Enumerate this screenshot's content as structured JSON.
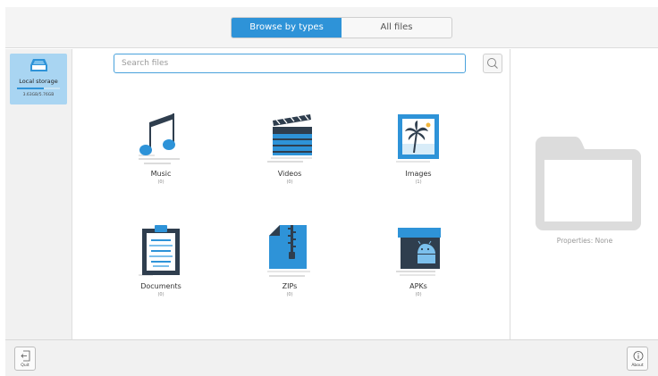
{
  "tabs": {
    "browse_by_types": "Browse by types",
    "all_files": "All files",
    "active": "browse_by_types"
  },
  "storage": {
    "label": "Local storage",
    "size": "3.63GB/5.76GB",
    "used_fraction": 0.63
  },
  "search": {
    "placeholder": "Search files",
    "value": ""
  },
  "categories": [
    {
      "label": "Music",
      "count": "(0)",
      "icon": "music-note-icon"
    },
    {
      "label": "Videos",
      "count": "(0)",
      "icon": "clapperboard-icon"
    },
    {
      "label": "Images",
      "count": "(1)",
      "icon": "picture-icon"
    },
    {
      "label": "Documents",
      "count": "(0)",
      "icon": "clipboard-document-icon"
    },
    {
      "label": "ZIPs",
      "count": "(0)",
      "icon": "zip-archive-icon"
    },
    {
      "label": "APKs",
      "count": "(0)",
      "icon": "android-package-icon"
    }
  ],
  "properties": {
    "text": "Properties: None"
  },
  "bottom": {
    "quit_label": "Quit",
    "about_label": "About"
  },
  "colors": {
    "accent": "#2e93d8",
    "storage_card": "#a9d5f2",
    "icon_dark": "#2f3e4e"
  }
}
